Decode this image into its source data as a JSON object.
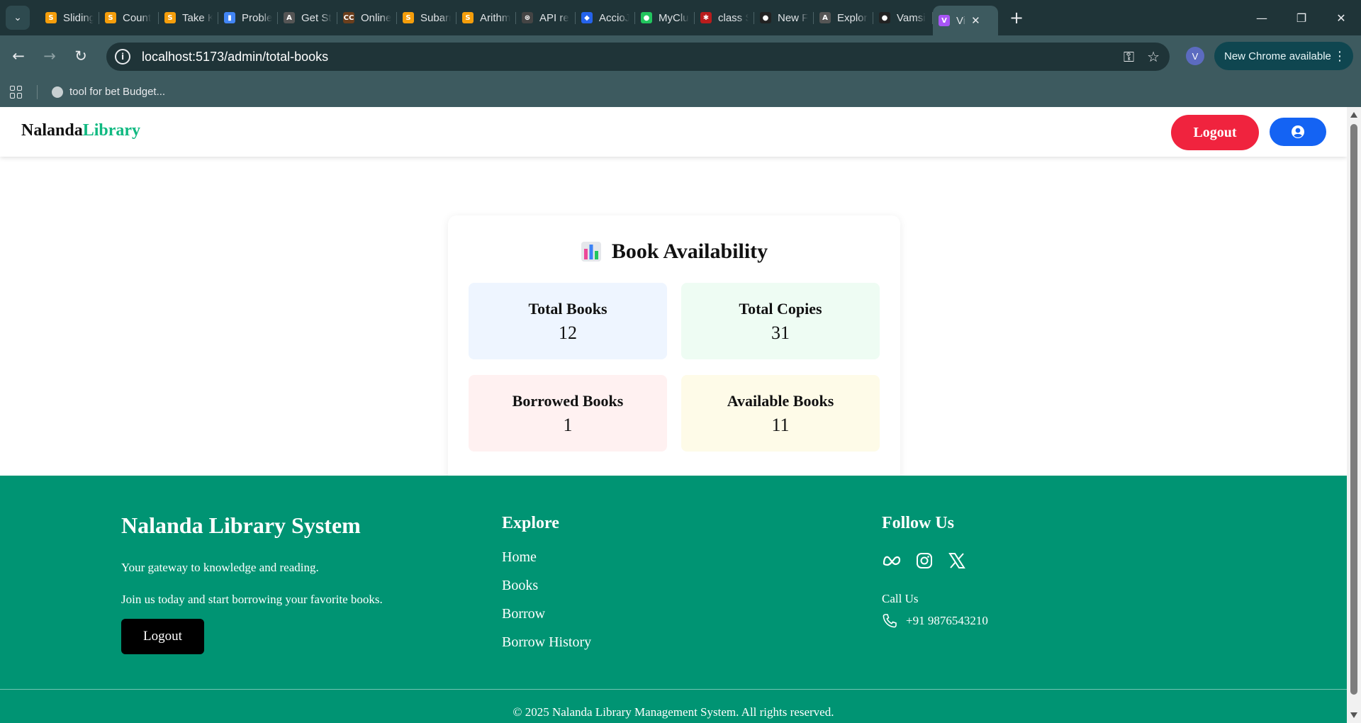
{
  "browser": {
    "tabs": [
      {
        "title": "Sliding",
        "fav": "S",
        "color": "#f59e0b"
      },
      {
        "title": "Count",
        "fav": "S",
        "color": "#f59e0b"
      },
      {
        "title": "Take K",
        "fav": "S",
        "color": "#f59e0b"
      },
      {
        "title": "Proble",
        "fav": "▮",
        "color": "#4285f4"
      },
      {
        "title": "Get St",
        "fav": "A",
        "color": "#555555"
      },
      {
        "title": "Online",
        "fav": "CC",
        "color": "#6b3e1c"
      },
      {
        "title": "Subarr",
        "fav": "S",
        "color": "#f59e0b"
      },
      {
        "title": "Arithm",
        "fav": "S",
        "color": "#f59e0b"
      },
      {
        "title": "API re",
        "fav": "⊛",
        "color": "#444444"
      },
      {
        "title": "AccioJ",
        "fav": "◆",
        "color": "#2563eb"
      },
      {
        "title": "MyClu",
        "fav": "●",
        "color": "#22c55e"
      },
      {
        "title": "class S",
        "fav": "✱",
        "color": "#b91c1c"
      },
      {
        "title": "New F",
        "fav": "●",
        "color": "#222222"
      },
      {
        "title": "Explor",
        "fav": "A",
        "color": "#555555"
      },
      {
        "title": "Vamsi",
        "fav": "●",
        "color": "#222222"
      }
    ],
    "active_tab": {
      "title": "Vi",
      "fav": "V",
      "color": "#a855f7"
    },
    "url": "localhost:5173/admin/total-books",
    "profile_initial": "V",
    "update_label": "New Chrome available",
    "bookmark": "tool for bet Budget..."
  },
  "navbar": {
    "brand_part1": "Nalanda",
    "brand_part2": "Library",
    "logout_label": "Logout"
  },
  "availability": {
    "title": "Book Availability",
    "stats": [
      {
        "label": "Total Books",
        "value": "12",
        "bg": "#eef5ff"
      },
      {
        "label": "Total Copies",
        "value": "31",
        "bg": "#eefcf3"
      },
      {
        "label": "Borrowed Books",
        "value": "1",
        "bg": "#fff1f1"
      },
      {
        "label": "Available Books",
        "value": "11",
        "bg": "#fefbe8"
      }
    ]
  },
  "footer": {
    "title": "Nalanda Library System",
    "tagline": "Your gateway to knowledge and reading.",
    "cta": "Join us today and start borrowing your favorite books.",
    "logout_label": "Logout",
    "explore_heading": "Explore",
    "links": [
      "Home",
      "Books",
      "Borrow",
      "Borrow History"
    ],
    "follow_heading": "Follow Us",
    "social_icons": [
      "meta-icon",
      "instagram-icon",
      "x-icon"
    ],
    "call_label": "Call Us",
    "phone": "+91 9876543210",
    "copyright": "© 2025 Nalanda Library Management System. All rights reserved."
  },
  "colors": {
    "accent_green": "#10b981",
    "footer_bg": "#009473",
    "logout_red": "#f0233e",
    "user_blue": "#1463f3"
  }
}
